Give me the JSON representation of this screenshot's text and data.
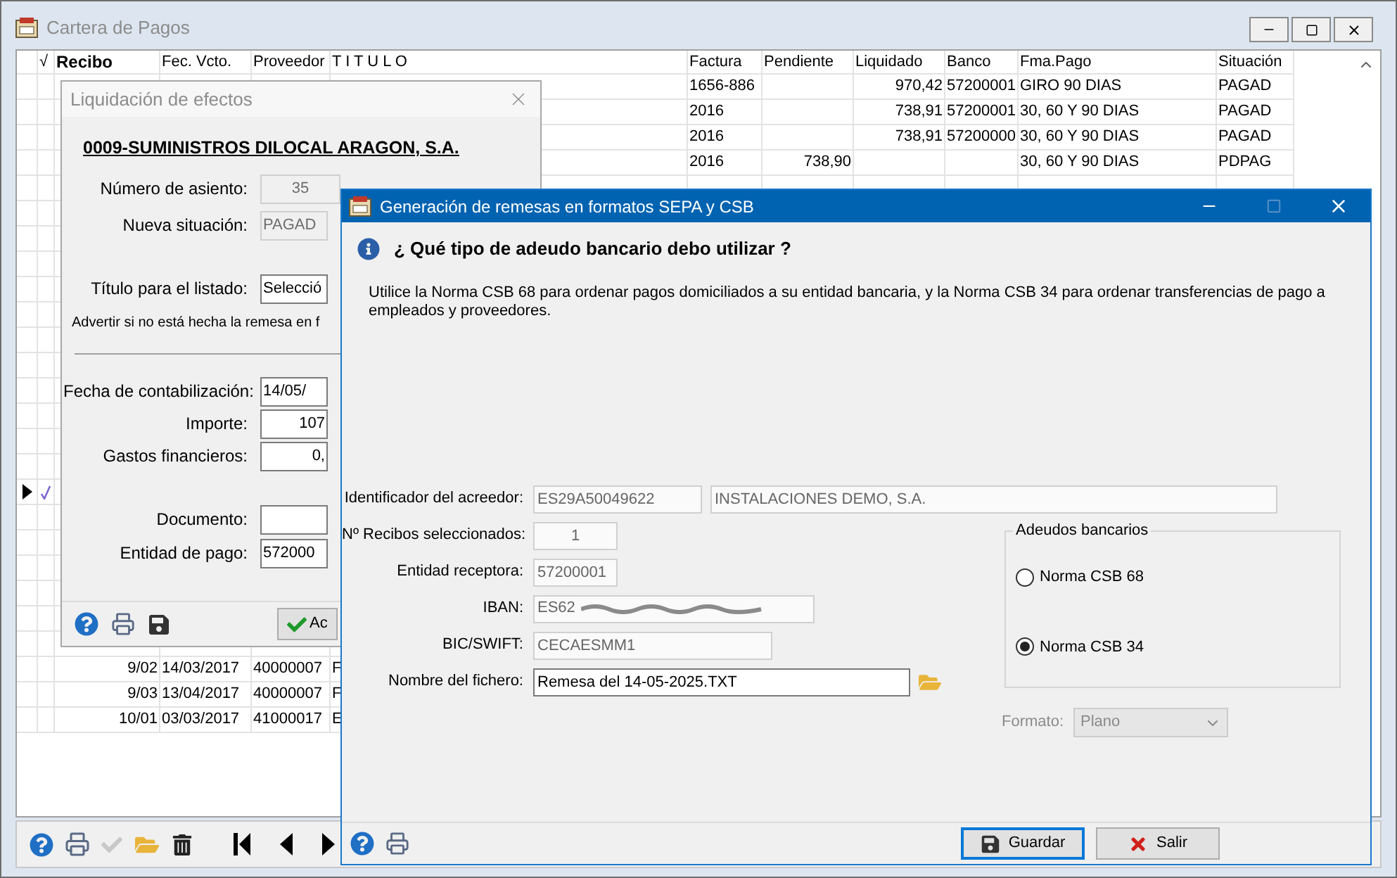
{
  "main_window": {
    "title": "Cartera de Pagos",
    "columns": [
      "√",
      "Recibo",
      "Fec. Vcto.",
      "Proveedor",
      "T I T U L O",
      "Factura",
      "Pendiente",
      "Liquidado",
      "Banco",
      "Fma.Pago",
      "Situación"
    ],
    "top_rows": [
      {
        "factura": "1656-886",
        "liquidado": "970,42",
        "banco": "57200001",
        "fma_pago": "GIRO 90 DIAS",
        "situacion": "PAGAD"
      },
      {
        "factura": "2016",
        "liquidado": "738,91",
        "banco": "57200001",
        "fma_pago": "30, 60 Y 90 DIAS",
        "situacion": "PAGAD"
      },
      {
        "factura": "2016",
        "liquidado": "738,91",
        "banco": "57200000",
        "fma_pago": "30, 60 Y 90 DIAS",
        "situacion": "PAGAD"
      },
      {
        "factura": "2016",
        "pendiente": "738,90",
        "fma_pago": "30, 60 Y 90 DIAS",
        "situacion": "PDPAG"
      }
    ],
    "current_row": {
      "selected": true,
      "checked": true
    },
    "bottom_rows": [
      {
        "recibo": "9/02",
        "fec_vcto": "14/03/2017",
        "proveedor": "40000007",
        "titulo": "F"
      },
      {
        "recibo": "9/03",
        "fec_vcto": "13/04/2017",
        "proveedor": "40000007",
        "titulo": "F"
      },
      {
        "recibo": "10/01",
        "fec_vcto": "03/03/2017",
        "proveedor": "41000017",
        "titulo": "E"
      }
    ],
    "toolbar": [
      {
        "kind": "help",
        "disabled": false
      },
      {
        "kind": "print",
        "disabled": false
      },
      {
        "kind": "check",
        "disabled": true
      },
      {
        "kind": "folder",
        "disabled": false
      },
      {
        "kind": "trash",
        "disabled": false
      },
      {
        "kind": "first",
        "disabled": false
      },
      {
        "kind": "prev",
        "disabled": false
      },
      {
        "kind": "next",
        "disabled": false
      }
    ]
  },
  "liquidation_dialog": {
    "title": "Liquidación de efectos",
    "company": "0009-SUMINISTROS DILOCAL ARAGON, S.A.",
    "general": [
      {
        "label": "Número de asiento:",
        "value": "35",
        "kind": "counter",
        "disabled": true
      },
      {
        "label": "Nueva situación:",
        "value": "PAGAD",
        "disabled": true
      }
    ],
    "listing": [
      {
        "label": "Título para el  listado:",
        "value": "Selecció",
        "disabled": false
      }
    ],
    "warning": "Advertir si no está hecha la remesa en f",
    "accounting": [
      {
        "label": "Fecha de contabilización:",
        "value": "14/05/",
        "disabled": false
      },
      {
        "label": "Importe:",
        "value": "107",
        "kind": "numeric",
        "disabled": false
      },
      {
        "label": "Gastos financieros:",
        "value": "0,",
        "kind": "numeric",
        "disabled": false
      }
    ],
    "payment": [
      {
        "label": "Documento:",
        "disabled": false
      },
      {
        "label": "Entidad de pago:",
        "value": "572000",
        "disabled": false
      }
    ],
    "button": "Ac"
  },
  "remittance_dialog": {
    "title": "Generación de remesas en formatos SEPA y CSB",
    "question": "¿ Qué tipo de adeudo bancario debo utilizar ?",
    "description": "Utilice la Norma CSB 68 para ordenar pagos domiciliados a su entidad bancaria, y la Norma CSB 34 para ordenar transferencias de pago a empleados y proveedores.",
    "fields": [
      {
        "label": "Identificador del acreedor:",
        "kind": "pair",
        "value": "ES29A50049622",
        "value_2": "INSTALACIONES DEMO, S.A.",
        "disabled": true
      },
      {
        "label": "Nº Recibos seleccionados:",
        "kind": "count",
        "value": "1",
        "disabled": true
      },
      {
        "label": "Entidad receptora:",
        "kind": "short",
        "value": "57200001",
        "disabled": true
      },
      {
        "label": "IBAN:",
        "kind": "iban",
        "value": "ES62",
        "redacted": true,
        "disabled": true
      },
      {
        "label": "BIC/SWIFT:",
        "kind": "medium",
        "value": "CECAESMM1",
        "disabled": true
      },
      {
        "label": "Nombre del fichero:",
        "kind": "file",
        "value": "Remesa del 14-05-2025.TXT",
        "disabled": false
      }
    ],
    "group": {
      "title": "Adeudos bancarios",
      "options": [
        {
          "label": "Norma CSB 68",
          "selected": false
        },
        {
          "label": "Norma CSB 34",
          "selected": true
        }
      ]
    },
    "format": {
      "label": "Formato:",
      "value": "Plano",
      "disabled": true
    },
    "buttons": [
      {
        "label": "Guardar",
        "kind": "save",
        "focused": true
      },
      {
        "label": "Salir",
        "kind": "exit",
        "focused": false
      }
    ]
  }
}
